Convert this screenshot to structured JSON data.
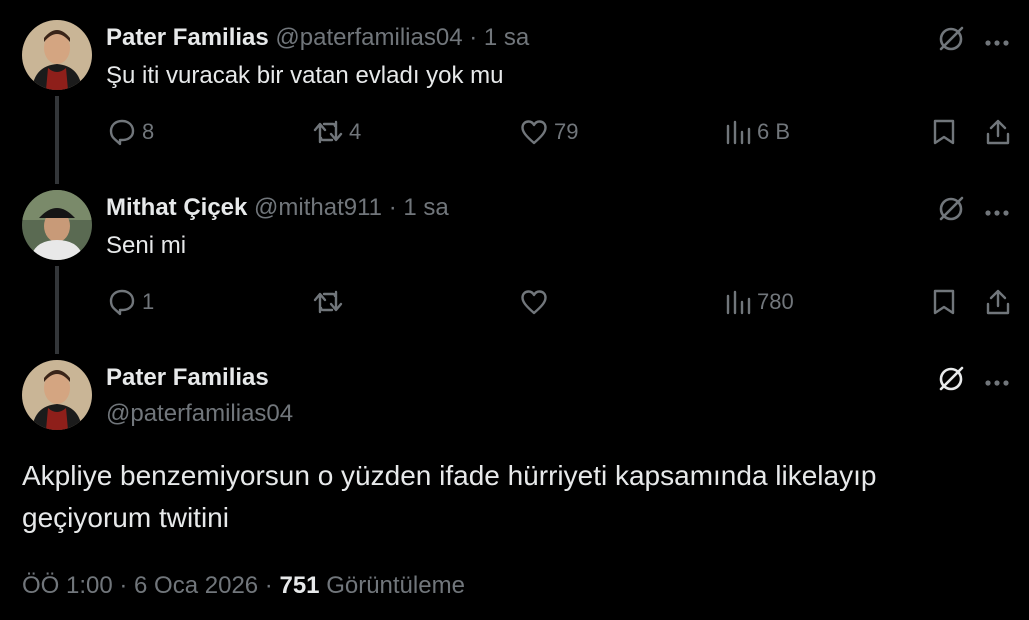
{
  "tweets": [
    {
      "display_name": "Pater Familias",
      "handle": "@paterfamilias04",
      "time": "· 1 sa",
      "text": "Şu iti vuracak bir vatan evladı yok mu",
      "replies": "8",
      "retweets": "4",
      "likes": "79",
      "views": "6 B"
    },
    {
      "display_name": "Mithat Çiçek",
      "handle": "@mithat911",
      "time": "· 1 sa",
      "text": "Seni mi",
      "replies": "1",
      "retweets": "",
      "likes": "",
      "views": "780"
    }
  ],
  "focused": {
    "display_name": "Pater Familias",
    "handle": "@paterfamilias04",
    "text": "Akpliye benzemiyorsun o yüzden ifade hürriyeti kapsamında likelayıp geçiyorum twitini",
    "timestamp": "ÖÖ 1:00 · 6 Oca 2026 ·",
    "view_count": "751",
    "view_label": "Görüntüleme"
  },
  "icons": {
    "grok": "grok-icon",
    "more": "more-icon",
    "reply": "reply-icon",
    "retweet": "retweet-icon",
    "like": "like-icon",
    "views": "views-icon",
    "bookmark": "bookmark-icon",
    "share": "share-icon"
  },
  "colors": {
    "background": "#000000",
    "text": "#e7e9ea",
    "muted": "#71767b",
    "thread_line": "#333639"
  }
}
